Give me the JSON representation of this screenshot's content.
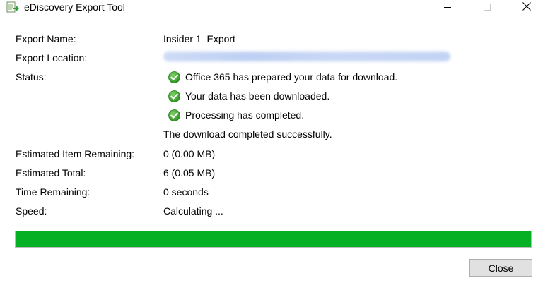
{
  "window": {
    "title": "eDiscovery Export Tool"
  },
  "labels": {
    "export_name": "Export Name:",
    "export_location": "Export Location:",
    "status": "Status:",
    "estimated_item_remaining": "Estimated Item Remaining:",
    "estimated_total": "Estimated Total:",
    "time_remaining": "Time Remaining:",
    "speed": "Speed:"
  },
  "values": {
    "export_name": "Insider 1_Export",
    "status_steps": [
      "Office 365 has prepared your data for download.",
      "Your data has been downloaded.",
      "Processing has completed."
    ],
    "status_summary": "The download completed successfully.",
    "estimated_item_remaining": "0 (0.00 MB)",
    "estimated_total": "6 (0.05 MB)",
    "time_remaining": "0 seconds",
    "speed": "Calculating ..."
  },
  "progress": {
    "fraction": 1.0,
    "color": "#06b025"
  },
  "buttons": {
    "close_label": "Close"
  },
  "icons": {
    "app": "export-app-icon",
    "status": "green-check-icon",
    "minimize": "minimize-icon",
    "maximize": "maximize-icon",
    "close": "close-icon"
  }
}
